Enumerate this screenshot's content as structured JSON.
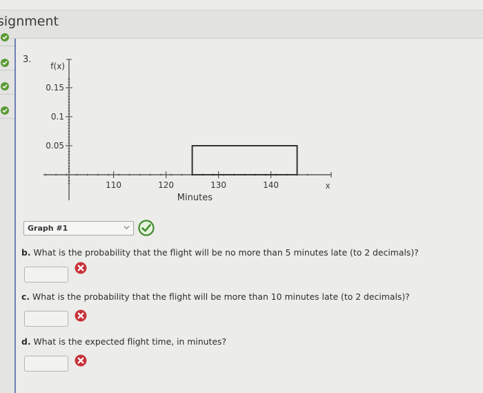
{
  "header": {
    "title": "signment"
  },
  "sidebar": {
    "items": [
      {
        "status": "correct",
        "icon": "check-circle-icon"
      },
      {
        "status": "correct",
        "icon": "check-circle-icon"
      },
      {
        "status": "correct",
        "icon": "check-circle-icon"
      },
      {
        "status": "correct",
        "icon": "check-circle-icon"
      }
    ]
  },
  "question": {
    "number": "3.",
    "graph_dropdown": {
      "selected": "Graph #1",
      "status": "correct"
    },
    "parts": [
      {
        "letter": "b.",
        "text": " What is the probability that the flight will be no more than 5 minutes late (to 2 decimals)?",
        "answer": "",
        "status": "incorrect"
      },
      {
        "letter": "c.",
        "text": " What is the probability that the flight will be more than 10 minutes late (to 2 decimals)?",
        "answer": "",
        "status": "incorrect"
      },
      {
        "letter": "d.",
        "text": " What is the expected flight time, in minutes?",
        "answer": "",
        "status": "incorrect"
      }
    ]
  },
  "chart_data": {
    "type": "uniform-density",
    "title": "",
    "ylabel": "f(x)",
    "xlabel": "Minutes",
    "x_axis_label": "x",
    "y_ticks": [
      {
        "value": 0.05,
        "label": "0.05"
      },
      {
        "value": 0.1,
        "label": "0.1"
      },
      {
        "value": 0.15,
        "label": "0.15"
      }
    ],
    "x_ticks": [
      {
        "value": 110,
        "label": "110"
      },
      {
        "value": 120,
        "label": "120"
      },
      {
        "value": 130,
        "label": "130"
      },
      {
        "value": 140,
        "label": "140"
      }
    ],
    "xlim": [
      96,
      147
    ],
    "ylim": [
      -0.016,
      0.17
    ],
    "rectangle": {
      "x_start": 125,
      "x_end": 145,
      "height": 0.05
    }
  },
  "colors": {
    "correct": "#5a9a33",
    "incorrect": "#c8333a",
    "sidebar_accent": "#6b7fb3"
  }
}
